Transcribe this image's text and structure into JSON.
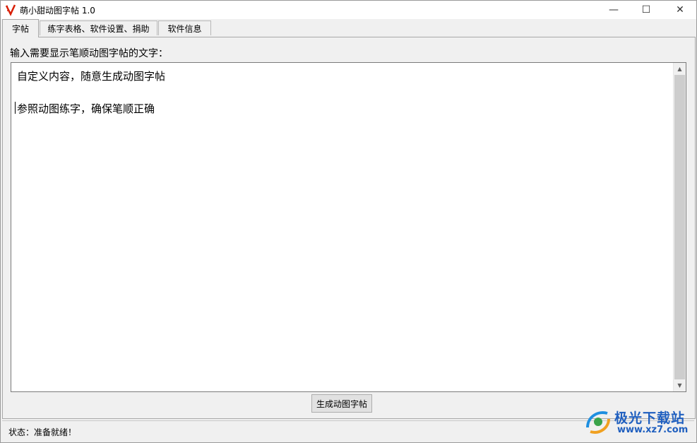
{
  "window": {
    "title": "萌小甜动图字帖 1.0",
    "controls": {
      "minimize": "—",
      "maximize": "☐",
      "close": "✕"
    }
  },
  "tabs": [
    {
      "label": "字帖",
      "active": true
    },
    {
      "label": "练字表格、软件设置、捐助",
      "active": false
    },
    {
      "label": "软件信息",
      "active": false
    }
  ],
  "main": {
    "prompt": "输入需要显示笔顺动图字帖的文字：",
    "text_lines": [
      "自定义内容，随意生成动图字帖",
      "参照动图练字，确保笔顺正确"
    ],
    "generate_button": "生成动图字帖"
  },
  "status": {
    "text": "状态：准备就绪！"
  },
  "watermark": {
    "title": "极光下载站",
    "url": "www.xz7.com"
  },
  "colors": {
    "watermark_blue": "#1f5fbf",
    "icon_red": "#d81e06"
  },
  "icons": {
    "app": "app-logo-icon",
    "watermark": "watermark-logo-icon"
  }
}
